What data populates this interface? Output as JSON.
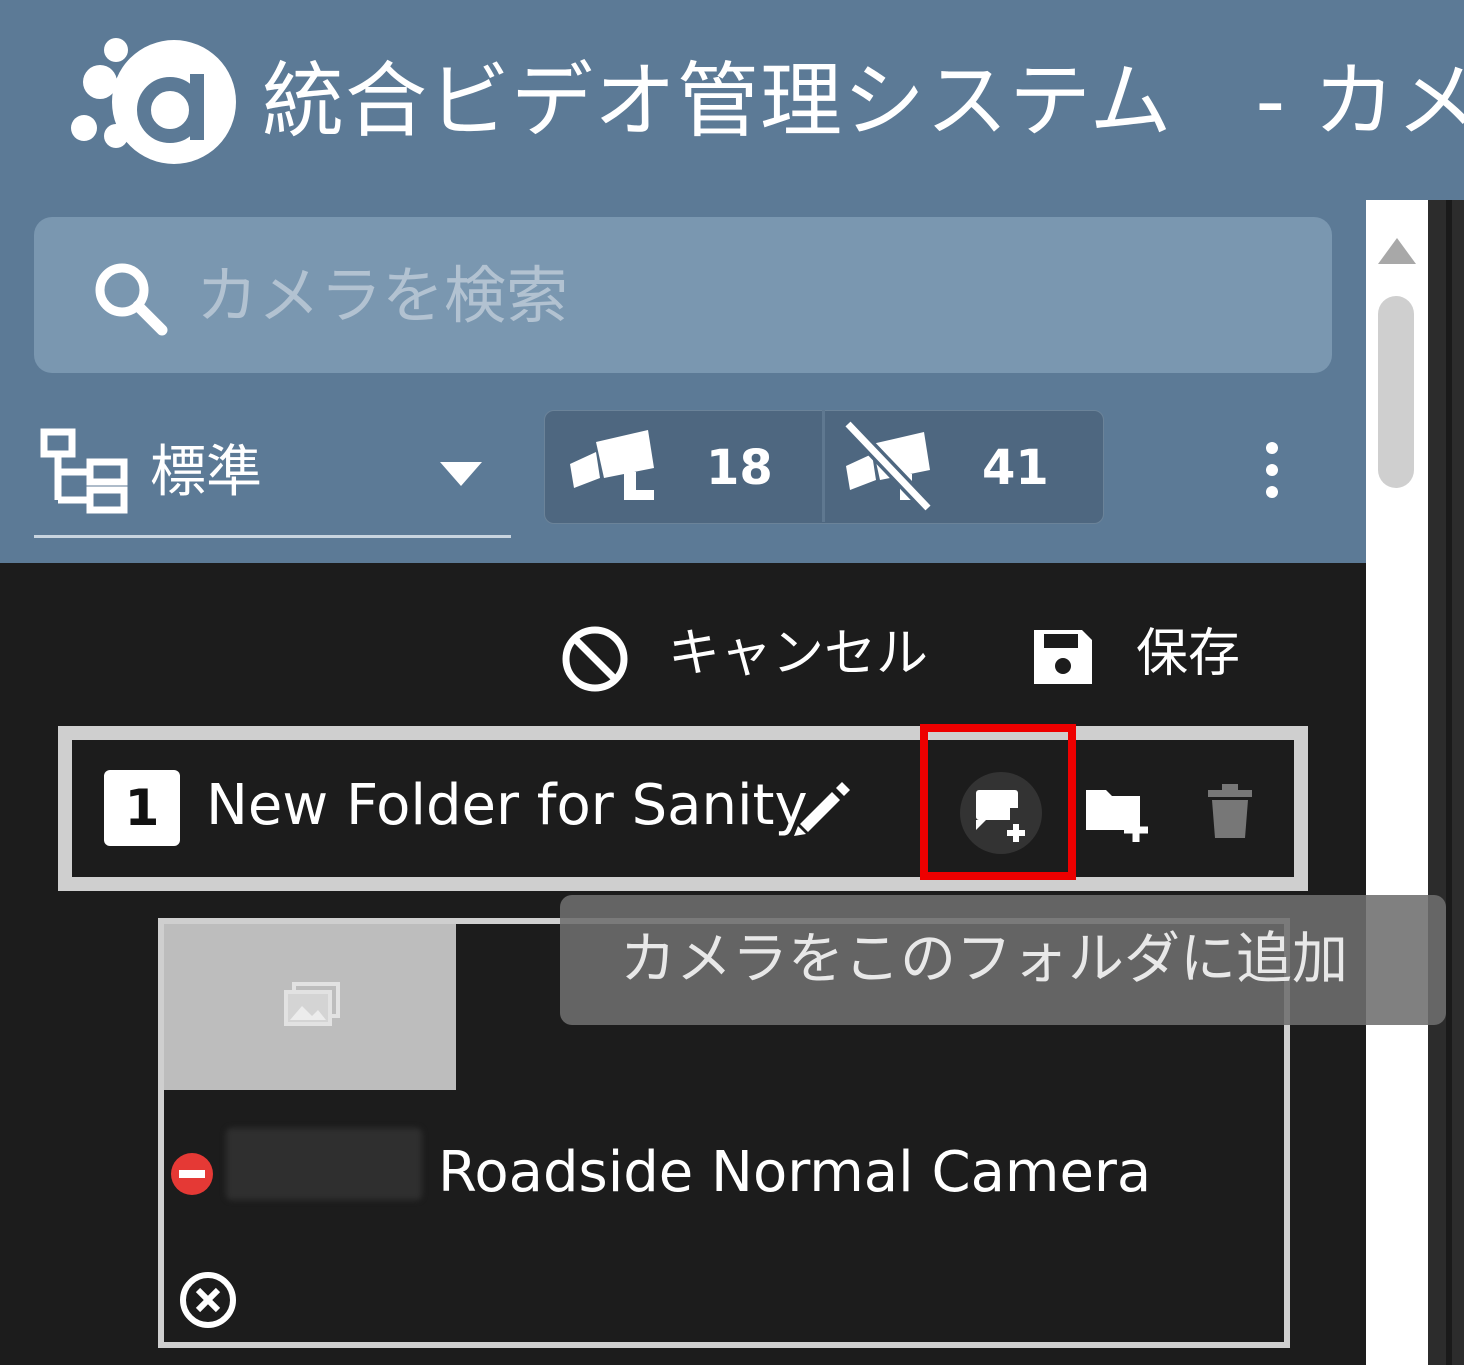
{
  "header": {
    "title": "統合ビデオ管理システム　- カメ",
    "logo_icon": "brand-logo"
  },
  "search": {
    "placeholder": "カメラを検索",
    "icon": "search-icon"
  },
  "view_selector": {
    "selected": "標準",
    "icon": "tree-structure-icon"
  },
  "camera_counts": {
    "online": "18",
    "offline": "41"
  },
  "actions": {
    "cancel_label": "キャンセル",
    "save_label": "保存"
  },
  "folder": {
    "index": "1",
    "name": "New Folder for Sanity"
  },
  "tooltip": {
    "text": "カメラをこのフォルダに追加"
  },
  "camera": {
    "name": "Roadside Normal Camera",
    "status_color": "#e53935"
  },
  "colors": {
    "header_bg": "#5c7a96",
    "panel_bg": "#1c1c1c",
    "highlight": "#ee0000",
    "search_bg": "#7a97b0"
  }
}
